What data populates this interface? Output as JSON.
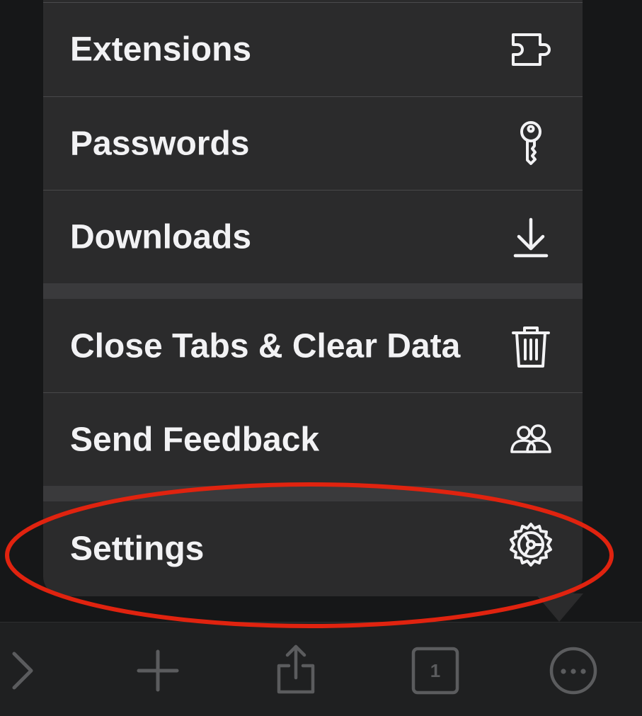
{
  "menu": {
    "items": [
      {
        "label": "Extensions",
        "icon": "puzzle-icon"
      },
      {
        "label": "Passwords",
        "icon": "key-icon"
      },
      {
        "label": "Downloads",
        "icon": "download-icon"
      },
      {
        "label": "Close Tabs & Clear Data",
        "icon": "trash-icon"
      },
      {
        "label": "Send Feedback",
        "icon": "people-icon"
      },
      {
        "label": "Settings",
        "icon": "gear-icon"
      }
    ]
  },
  "toolbar": {
    "tab_count": "1",
    "buttons": [
      "forward-icon",
      "new-tab-icon",
      "share-icon",
      "tabs-icon",
      "more-icon"
    ]
  },
  "colors": {
    "menu_bg": "#2b2b2c",
    "text": "#f2f2f4",
    "highlight": "#e0230f",
    "toolbar_bg": "#1f2021",
    "toolbar_icon": "#5b5c5e"
  }
}
